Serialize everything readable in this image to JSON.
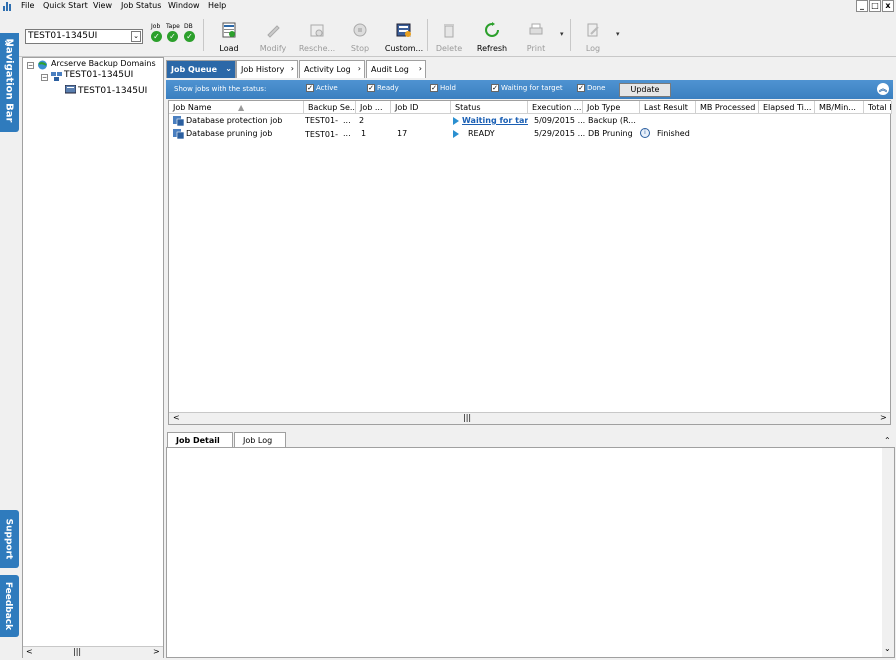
{
  "menu": [
    "File",
    "Quick Start",
    "View",
    "Job Status",
    "Window",
    "Help"
  ],
  "window_controls": [
    "_",
    "□",
    "x"
  ],
  "server_select": {
    "value": "TEST01-1345UI",
    "arrow": "⌄"
  },
  "status_indicators": [
    {
      "label": "Job",
      "state": "ok"
    },
    {
      "label": "Tape",
      "state": "ok"
    },
    {
      "label": "DB",
      "state": "ok"
    }
  ],
  "toolbar": {
    "load": "Load",
    "modify": "Modify",
    "reschedule": "Resche...",
    "stop": "Stop",
    "customize": "Custom...",
    "delete": "Delete",
    "refresh": "Refresh",
    "print": "Print",
    "log": "Log"
  },
  "side": {
    "navigation": "Navigation Bar",
    "support": "Support",
    "feedback": "Feedback",
    "nav_chevron": "»"
  },
  "tree": {
    "root": "Arcserve Backup Domains",
    "domain": "TEST01-1345UI",
    "server": "TEST01-1345UI"
  },
  "tabs": [
    "Job Queue",
    "Job History",
    "Activity Log",
    "Audit Log"
  ],
  "filter": {
    "label": "Show jobs with the status:",
    "options": [
      "Active",
      "Ready",
      "Hold",
      "Waiting for target",
      "Done"
    ],
    "update": "Update"
  },
  "table": {
    "headers": [
      "Job Name",
      "Backup Se...",
      "Job ...",
      "Job ID",
      "Status",
      "Execution ...",
      "Job Type",
      "Last Result",
      "MB Processed",
      "Elapsed Ti...",
      "MB/Min...",
      "Total F"
    ],
    "rows": [
      {
        "name": "Database protection job",
        "server": "TEST01-",
        "server_more": "...",
        "job_no": "2",
        "job_id": "",
        "status": "Waiting for targe",
        "exec": "5/09/2015 ...",
        "type": "Backup (R...",
        "result": ""
      },
      {
        "name": "Database pruning job",
        "server": "TEST01-",
        "server_more": "...",
        "job_no": "1",
        "job_id": "17",
        "status": "READY",
        "exec": "5/29/2015 ...",
        "type": "DB Pruning",
        "result": "Finished"
      }
    ]
  },
  "detail_tabs": [
    "Job Detail",
    "Job Log"
  ],
  "colors": {
    "accent": "#2f7bbd",
    "active_tab": "#2b68a8",
    "link": "#1a5fb4",
    "ok": "#2ca02c"
  }
}
